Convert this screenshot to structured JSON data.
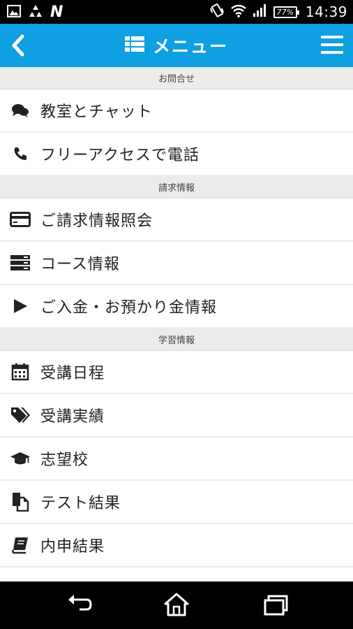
{
  "status_bar": {
    "time": "14:39",
    "battery": "77%",
    "carrier_logo": "N",
    "icons": [
      "image-icon",
      "recycle-icon",
      "n-logo-icon",
      "vibrate-icon",
      "wifi-icon",
      "signal-icon",
      "battery-icon"
    ]
  },
  "app_bar": {
    "title": "メニュー",
    "title_icon": "list-icon",
    "back_icon": "chevron-left-icon",
    "menu_icon": "hamburger-menu-icon",
    "color": "#0ea0e0"
  },
  "sections": [
    {
      "header": "お問合せ",
      "items": [
        {
          "label": "教室とチャット",
          "icon": "chat-icon"
        },
        {
          "label": "フリーアクセスで電話",
          "icon": "phone-icon"
        }
      ]
    },
    {
      "header": "請求情報",
      "items": [
        {
          "label": "ご請求情報照会",
          "icon": "credit-card-icon"
        },
        {
          "label": "コース情報",
          "icon": "server-icon"
        },
        {
          "label": "ご入金・お預かり金情報",
          "icon": "play-icon"
        }
      ]
    },
    {
      "header": "学習情報",
      "items": [
        {
          "label": "受講日程",
          "icon": "calendar-icon"
        },
        {
          "label": "受講実績",
          "icon": "tags-icon"
        },
        {
          "label": "志望校",
          "icon": "graduation-cap-icon"
        },
        {
          "label": "テスト結果",
          "icon": "documents-icon"
        },
        {
          "label": "内申結果",
          "icon": "book-icon"
        }
      ]
    }
  ],
  "nav_bar": {
    "icons": [
      "back-icon",
      "home-icon",
      "recent-apps-icon"
    ]
  }
}
